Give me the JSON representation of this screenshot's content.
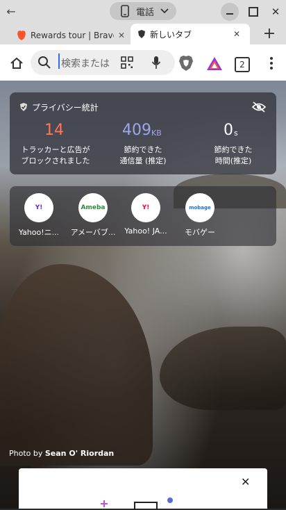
{
  "window": {
    "back_label": "←",
    "device_label": "電話",
    "minimize_label": "—",
    "maximize_label": "□",
    "close_label": "✕"
  },
  "tabs": [
    {
      "title": "Rewards tour | Brave",
      "close": "✕"
    },
    {
      "title": "新しいタブ",
      "close": "✕"
    }
  ],
  "new_tab_label": "+",
  "toolbar": {
    "search_placeholder": "検索または",
    "tab_count": "2"
  },
  "privacy_stats": {
    "title": "プライバシー統計",
    "trackers_value": "14",
    "trackers_label_line1": "トラッカーと広告が",
    "trackers_label_line2": "ブロックされました",
    "bandwidth_value": "409",
    "bandwidth_unit": "KB",
    "bandwidth_label_line1": "節約できた",
    "bandwidth_label_line2": "通信量 (推定)",
    "time_value": "0",
    "time_unit": "s",
    "time_label_line1": "節約できた",
    "time_label_line2": "時間(推定)"
  },
  "top_sites": [
    {
      "label": "Yahoo!ニ...",
      "icon_text": "Y!"
    },
    {
      "label": "アメーバブ...",
      "icon_text": "Ameba"
    },
    {
      "label": "Yahoo! JA...",
      "icon_text": "Y!"
    },
    {
      "label": "モバゲー",
      "icon_text": "mobage"
    }
  ],
  "photo_credit_prefix": "Photo by ",
  "photo_credit_name": "Sean O' Riordan",
  "bottom_card": {
    "close": "✕"
  },
  "colors": {
    "trackers": "#ff7654",
    "bandwidth": "#a0a5eb",
    "time": "#ffffff",
    "brave_orange": "#fb542b"
  }
}
